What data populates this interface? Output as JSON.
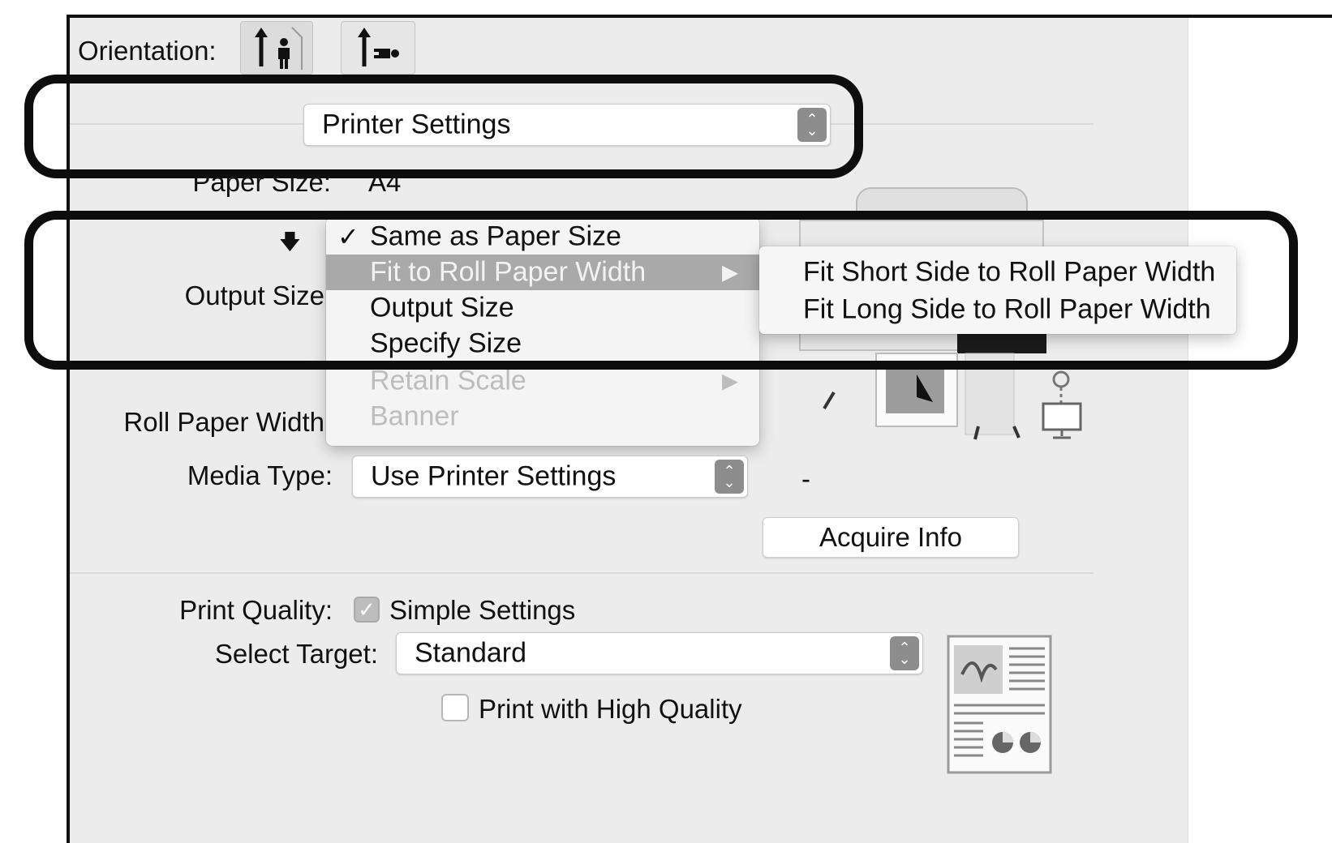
{
  "orientation": {
    "label": "Orientation:"
  },
  "panel_popup": {
    "value": "Printer Settings"
  },
  "paper_size": {
    "label": "Paper Size:",
    "value": "A4"
  },
  "output_size": {
    "label": "Output Size"
  },
  "roll_paper_width": {
    "label": "Roll Paper Width"
  },
  "output_menu": {
    "items": [
      {
        "label": "Same as Paper Size",
        "checked": true,
        "enabled": true
      },
      {
        "label": "Fit to Roll Paper Width",
        "highlighted": true,
        "has_submenu": true,
        "enabled": true
      },
      {
        "label": "Output Size",
        "enabled": true
      },
      {
        "label": "Specify Size",
        "enabled": true
      },
      {
        "label": "Retain Scale",
        "has_submenu": true,
        "enabled": false
      },
      {
        "label": "Banner",
        "enabled": false
      }
    ],
    "check_mark": "✓",
    "submenu_arrow": "▶"
  },
  "fit_submenu": {
    "items": [
      {
        "label": "Fit Short Side to Roll Paper Width"
      },
      {
        "label": "Fit Long Side to Roll Paper Width"
      }
    ]
  },
  "media_type": {
    "label": "Media Type:",
    "value": "Use Printer Settings",
    "info": "-"
  },
  "acquire_info": {
    "label": "Acquire Info"
  },
  "print_quality": {
    "label": "Print Quality:",
    "simple_settings_label": "Simple Settings",
    "simple_settings_checked": true
  },
  "select_target": {
    "label": "Select Target:",
    "value": "Standard"
  },
  "high_quality": {
    "label": "Print with High Quality",
    "checked": false
  },
  "icons": {
    "portrait": "portrait-orientation-icon",
    "landscape": "landscape-orientation-icon",
    "printer": "printer-illustration-icon",
    "computer": "computer-icon",
    "preview": "document-preview-icon"
  }
}
